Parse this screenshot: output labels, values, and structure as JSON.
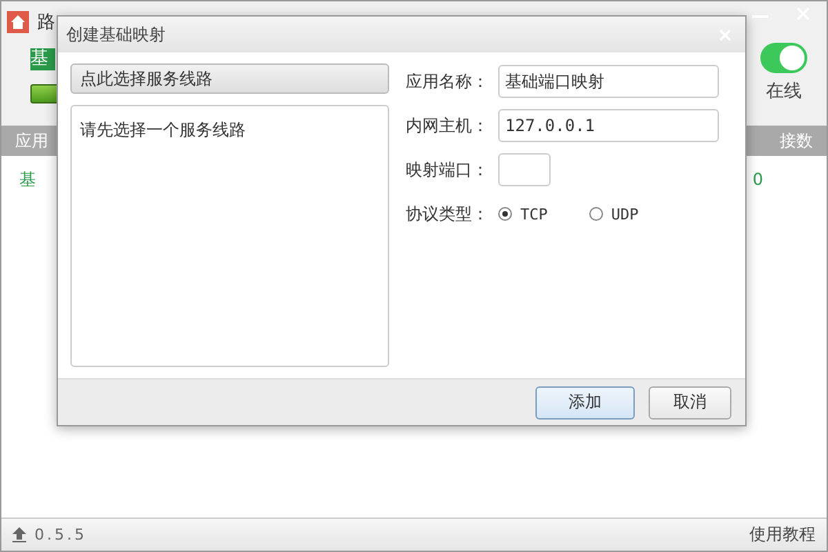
{
  "app": {
    "title": "路",
    "group_label": "基",
    "online": {
      "on": true,
      "label": "在线"
    },
    "table": {
      "columns": [
        "应用",
        "接数"
      ],
      "rows": [
        [
          "基",
          "0"
        ]
      ]
    },
    "status_bar": {
      "version": "0.5.5",
      "help_link": "使用教程"
    }
  },
  "dialog": {
    "title": "创建基础映射",
    "select_button": "点此选择服务线路",
    "list_message": "请先选择一个服务线路",
    "fields": [
      {
        "label": "应用名称：",
        "value": "基础端口映射",
        "kind": "wide"
      },
      {
        "label": "内网主机：",
        "value": "127.0.0.1",
        "kind": "wide"
      },
      {
        "label": "映射端口：",
        "kind": "short"
      }
    ],
    "protocol": {
      "label": "协议类型：",
      "options": [
        {
          "label": "TCP",
          "selected": true
        },
        {
          "label": "UDP",
          "selected": false
        }
      ]
    },
    "buttons": [
      {
        "label": "添加",
        "primary": true
      },
      {
        "label": "取消",
        "primary": false
      }
    ]
  }
}
